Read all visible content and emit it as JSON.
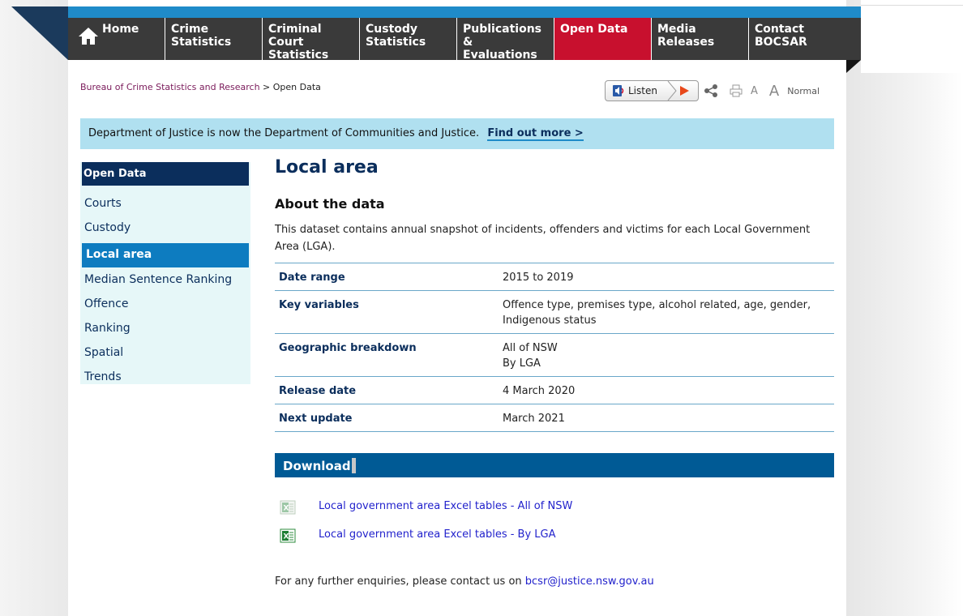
{
  "nav": {
    "items": [
      {
        "label_line1": "Home",
        "label_line2": ""
      },
      {
        "label_line1": "Crime",
        "label_line2": "Statistics"
      },
      {
        "label_line1": "Criminal Court",
        "label_line2": "Statistics"
      },
      {
        "label_line1": "Custody",
        "label_line2": "Statistics"
      },
      {
        "label_line1": "Publications &",
        "label_line2": "Evaluations"
      },
      {
        "label_line1": "Open Data",
        "label_line2": ""
      },
      {
        "label_line1": "Media",
        "label_line2": "Releases"
      },
      {
        "label_line1": "Contact",
        "label_line2": "BOCSAR"
      }
    ],
    "active_color": "#c8102e",
    "bg_color": "#3a3a3a",
    "home_icon": "home-icon"
  },
  "breadcrumb": {
    "parent": "Bureau of Crime Statistics and Research",
    "separator": ">",
    "current": "Open Data"
  },
  "tools": {
    "listen_label": "Listen",
    "font_small": "A",
    "font_large": "A",
    "font_normal": "Normal",
    "icons": [
      "speaker-icon",
      "play-icon",
      "share-icon",
      "print-icon"
    ]
  },
  "notice": {
    "text": "Department of Justice is now the Department of Communities and Justice.",
    "link": "Find out more >"
  },
  "sidebar": {
    "heading": "Open Data",
    "items": [
      {
        "label": "Courts"
      },
      {
        "label": "Custody"
      },
      {
        "label": "Local area"
      },
      {
        "label": "Median Sentence Ranking"
      },
      {
        "label": "Offence"
      },
      {
        "label": "Ranking"
      },
      {
        "label": "Spatial"
      },
      {
        "label": "Trends"
      }
    ],
    "active_index": 2
  },
  "main": {
    "title": "Local area",
    "about_heading": "About the data",
    "description": "This dataset contains annual snapshot of incidents, offenders and victims for each Local Government Area (LGA).",
    "meta": [
      {
        "key": "Date range",
        "value": "2015 to 2019"
      },
      {
        "key": "Key variables",
        "value": "Offence type, premises type, alcohol related, age, gender,\nIndigenous status"
      },
      {
        "key": "Geographic breakdown",
        "value": "All of NSW\nBy LGA"
      },
      {
        "key": "Release date",
        "value": "4 March 2020"
      },
      {
        "key": "Next update",
        "value": "March 2021"
      }
    ],
    "download_heading": "Download",
    "downloads": [
      {
        "label": "Local government area Excel tables - All of NSW",
        "icon": "excel-icon"
      },
      {
        "label": "Local government area Excel tables - By LGA",
        "icon": "excel-icon"
      }
    ],
    "enquiry_text": "For any further enquiries, please contact us on",
    "enquiry_email": "bcsr@justice.nsw.gov.au"
  }
}
